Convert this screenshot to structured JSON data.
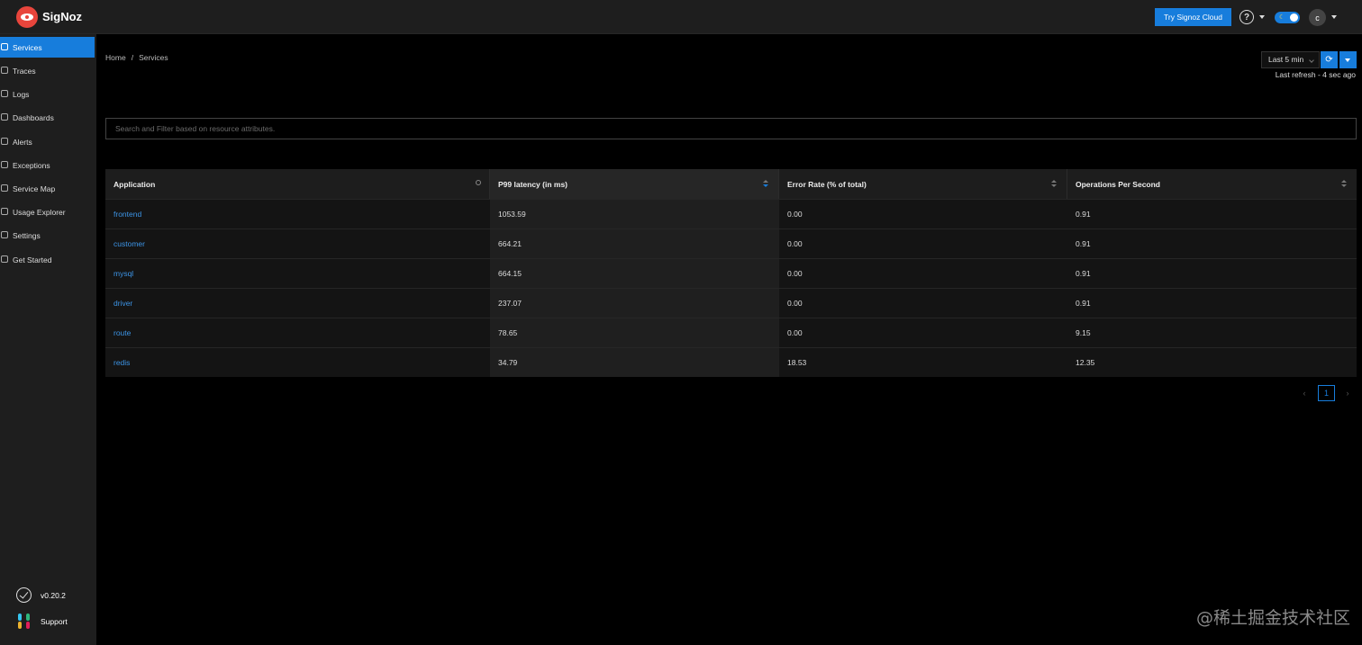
{
  "header": {
    "brand": "SigNoz",
    "cloud_button": "Try Signoz Cloud",
    "help_glyph": "?",
    "avatar_initial": "c",
    "theme_icon": "moon-icon"
  },
  "sidebar": {
    "items": [
      {
        "label": "Services",
        "icon": "bar-chart-icon",
        "active": true
      },
      {
        "label": "Traces",
        "icon": "menu-icon"
      },
      {
        "label": "Logs",
        "icon": "list-icon"
      },
      {
        "label": "Dashboards",
        "icon": "dashboard-icon"
      },
      {
        "label": "Alerts",
        "icon": "bell-icon"
      },
      {
        "label": "Exceptions",
        "icon": "bug-icon"
      },
      {
        "label": "Service Map",
        "icon": "deployment-icon"
      },
      {
        "label": "Usage Explorer",
        "icon": "line-chart-icon"
      },
      {
        "label": "Settings",
        "icon": "gear-icon"
      },
      {
        "label": "Get Started",
        "icon": "rocket-icon"
      }
    ],
    "version": "v0.20.2",
    "support": "Support"
  },
  "breadcrumb": {
    "home": "Home",
    "separator": "/",
    "current": "Services"
  },
  "time_range": {
    "selected": "Last 5 min",
    "refresh_glyph": "⟳",
    "last_refresh": "Last refresh - 4 sec ago"
  },
  "search": {
    "placeholder": "Search and Filter based on resource attributes."
  },
  "table": {
    "columns": [
      "Application",
      "P99 latency (in ms)",
      "Error Rate (% of total)",
      "Operations Per Second"
    ],
    "rows": [
      {
        "application": "frontend",
        "p99": "1053.59",
        "error_rate": "0.00",
        "ops": "0.91"
      },
      {
        "application": "customer",
        "p99": "664.21",
        "error_rate": "0.00",
        "ops": "0.91"
      },
      {
        "application": "mysql",
        "p99": "664.15",
        "error_rate": "0.00",
        "ops": "0.91"
      },
      {
        "application": "driver",
        "p99": "237.07",
        "error_rate": "0.00",
        "ops": "0.91"
      },
      {
        "application": "route",
        "p99": "78.65",
        "error_rate": "0.00",
        "ops": "9.15"
      },
      {
        "application": "redis",
        "p99": "34.79",
        "error_rate": "18.53",
        "ops": "12.35"
      }
    ]
  },
  "pagination": {
    "prev": "‹",
    "current": "1",
    "next": "›"
  },
  "watermark": "@稀土掘金技术社区",
  "colors": {
    "accent": "#177ddc",
    "link": "#3c94e6",
    "logo": "#e8453c"
  }
}
